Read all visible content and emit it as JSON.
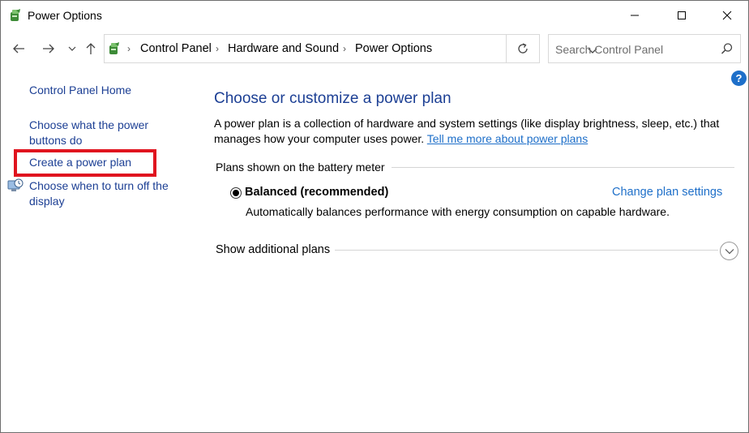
{
  "window": {
    "title": "Power Options",
    "icon": "power-options-icon"
  },
  "titlebar_buttons": [
    "minimize-icon",
    "maximize-icon",
    "close-icon"
  ],
  "nav": {
    "back_icon": "arrow-left-icon",
    "forward_icon": "arrow-right-icon",
    "recent_icon": "chevron-down-icon",
    "up_icon": "arrow-up-icon"
  },
  "address": {
    "crumbs": [
      "Control Panel",
      "Hardware and Sound",
      "Power Options"
    ]
  },
  "search": {
    "placeholder": "Search Control Panel"
  },
  "help_label": "?",
  "sidebar": {
    "items": [
      {
        "label": "Control Panel Home"
      },
      {
        "label_line1": "Choose what the power",
        "label_line2": "buttons do"
      },
      {
        "label": "Create a power plan",
        "highlighted": true
      },
      {
        "label_line1": "Choose when to turn off the",
        "label_line2": "display"
      }
    ]
  },
  "main": {
    "title": "Choose or customize a power plan",
    "description": "A power plan is a collection of hardware and system settings (like display brightness, sleep, etc.) that manages how your computer uses power. ",
    "description_link": "Tell me more about power plans",
    "group_label": "Plans shown on the battery meter",
    "plan": {
      "name": "Balanced (recommended)",
      "selected": true,
      "settings_link": "Change plan settings",
      "description": "Automatically balances performance with energy consumption on capable hardware."
    },
    "more_plans_label": "Show additional plans"
  },
  "colors": {
    "link": "#1e6fc9",
    "heading": "#1c3f94",
    "highlight_box": "#e0141f"
  }
}
